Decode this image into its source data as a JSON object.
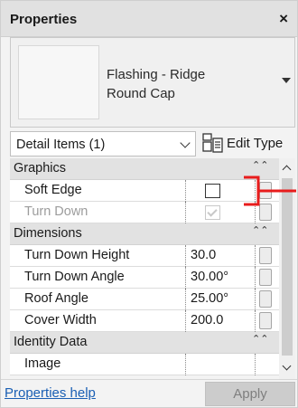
{
  "window": {
    "title": "Properties",
    "close_symbol": "×"
  },
  "type_selector": {
    "name_line1": "Flashing - Ridge",
    "name_line2": "Round Cap"
  },
  "filter": {
    "selected": "Detail Items (1)"
  },
  "edit_type": {
    "label": "Edit Type"
  },
  "groups": {
    "graphics": {
      "label": "Graphics",
      "collapse_symbol": "⌃⌃"
    },
    "dimensions": {
      "label": "Dimensions",
      "collapse_symbol": "⌃⌃"
    },
    "identity": {
      "label": "Identity Data",
      "collapse_symbol": "⌃⌃"
    }
  },
  "properties": [
    {
      "name": "Soft Edge",
      "control": "checkbox",
      "checked": false,
      "enabled": true
    },
    {
      "name": "Turn Down",
      "control": "checkbox",
      "checked": true,
      "enabled": false
    },
    {
      "name": "Turn Down Height",
      "value": "30.0"
    },
    {
      "name": "Turn Down Angle",
      "value": "30.00°"
    },
    {
      "name": "Roof Angle",
      "value": "25.00°"
    },
    {
      "name": "Cover Width",
      "value": "200.0"
    },
    {
      "name": "Image",
      "value": ""
    }
  ],
  "footer": {
    "help_link": "Properties help",
    "apply_label": "Apply",
    "apply_enabled": false
  },
  "annotation": {
    "color": "#e81c1c"
  },
  "icons": {
    "close": "close-icon",
    "dropdown": "chevron-down-icon",
    "edit_type": "edit-type-icon",
    "collapse": "collapse-icon"
  }
}
